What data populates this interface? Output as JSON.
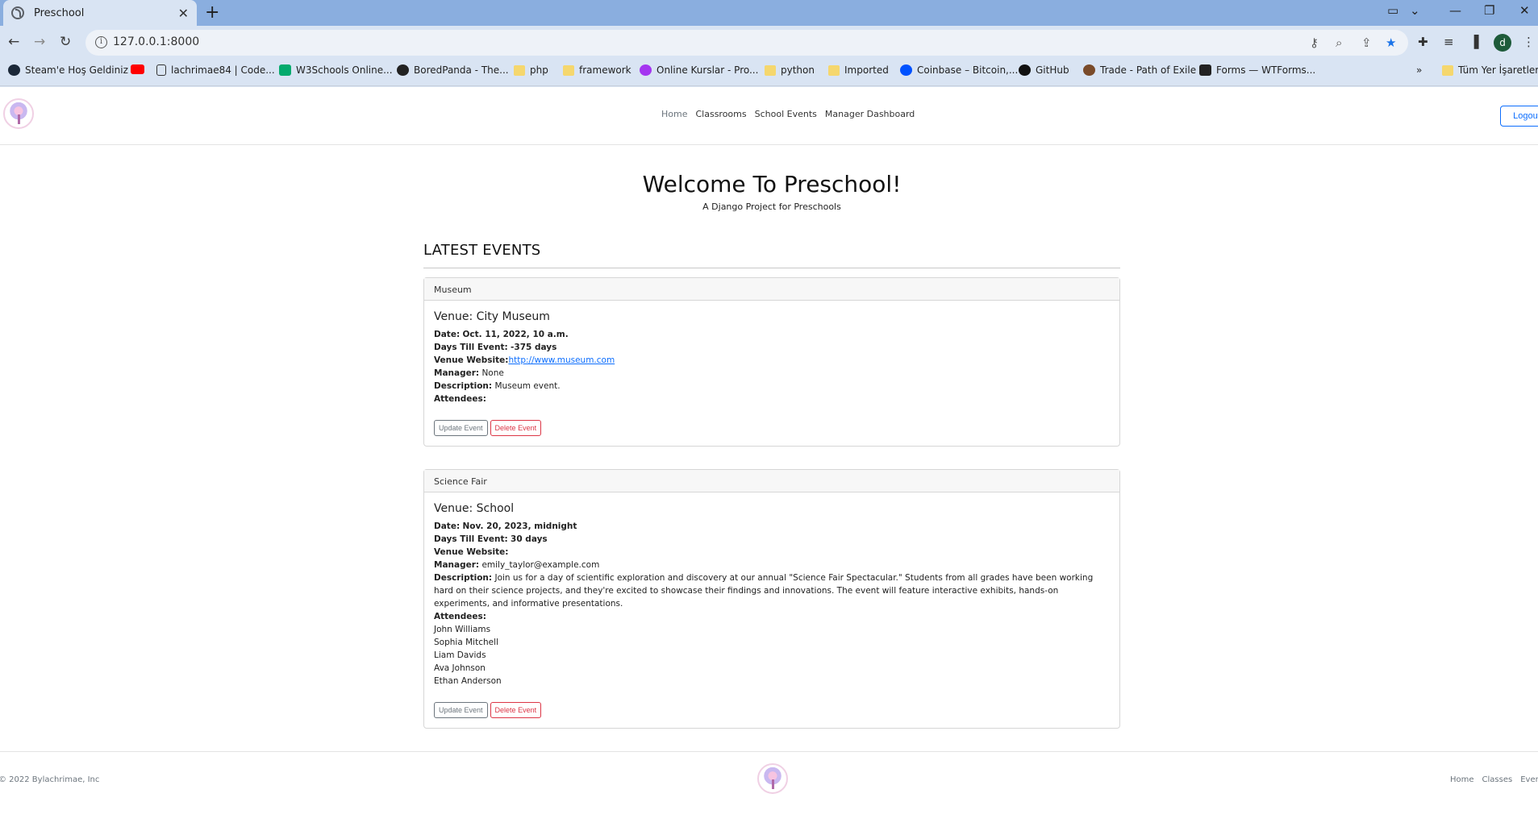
{
  "browser": {
    "tab_title": "Preschool",
    "url": "127.0.0.1:8000",
    "profile_initial": "d",
    "bookmarks": [
      "Steam'e Hoş Geldiniz",
      "",
      "lachrimae84 | Code...",
      "W3Schools Online...",
      "BoredPanda - The...",
      "php",
      "framework",
      "Online Kurslar - Pro...",
      "python",
      "Imported",
      "Coinbase – Bitcoin,...",
      "GitHub",
      "Trade - Path of Exile",
      "Forms — WTForms...",
      "Tüm Yer İşaretleri"
    ]
  },
  "header": {
    "nav": [
      "Home",
      "Classrooms",
      "School Events",
      "Manager Dashboard"
    ],
    "logout": "Logout"
  },
  "hero": {
    "title": "Welcome To Preschool!",
    "subtitle": "A Django Project for Preschools"
  },
  "events_heading": "LATEST EVENTS",
  "events": [
    {
      "name": "Museum",
      "venue": "Venue: City Museum",
      "date_label": "Date:",
      "date": "Oct. 11, 2022, 10 a.m.",
      "days_label": "Days Till Event:",
      "days": "-375 days",
      "website_label": "Venue Website:",
      "website": "http://www.museum.com",
      "manager_label": "Manager:",
      "manager": "None",
      "description_label": "Description:",
      "description": "Museum event.",
      "attendees_label": "Attendees:",
      "attendees": [],
      "update_label": "Update Event",
      "delete_label": "Delete Event"
    },
    {
      "name": "Science Fair",
      "venue": "Venue: School",
      "date_label": "Date:",
      "date": "Nov. 20, 2023, midnight",
      "days_label": "Days Till Event:",
      "days": "30 days",
      "website_label": "Venue Website:",
      "website": "",
      "manager_label": "Manager:",
      "manager": "emily_taylor@example.com",
      "description_label": "Description:",
      "description": "Join us for a day of scientific exploration and discovery at our annual \"Science Fair Spectacular.\" Students from all grades have been working hard on their science projects, and they're excited to showcase their findings and innovations. The event will feature interactive exhibits, hands-on experiments, and informative presentations.",
      "attendees_label": "Attendees:",
      "attendees": [
        "John Williams",
        "Sophia Mitchell",
        "Liam Davids",
        "Ava Johnson",
        "Ethan Anderson"
      ],
      "update_label": "Update Event",
      "delete_label": "Delete Event"
    }
  ],
  "footer": {
    "copyright": "© 2022 Bylachrimae, Inc",
    "nav": [
      "Home",
      "Classes",
      "Events"
    ]
  },
  "colors": {
    "primary": "#0d6efd",
    "danger": "#dc3545",
    "secondary": "#6c757d",
    "tabbar": "#8aaedf",
    "toolbar": "#d9e4f3"
  }
}
